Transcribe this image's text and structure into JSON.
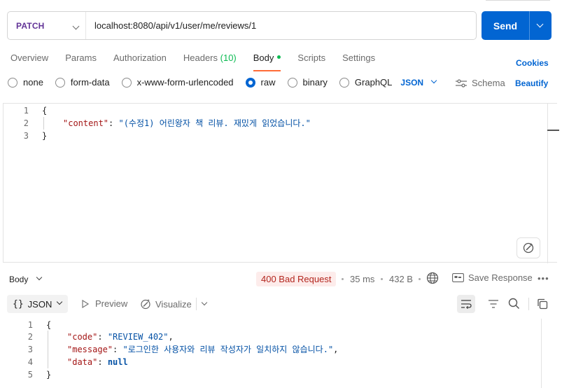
{
  "request": {
    "method": "PATCH",
    "url": "localhost:8080/api/v1/user/me/reviews/1",
    "send_label": "Send"
  },
  "tabs": [
    {
      "label": "Overview"
    },
    {
      "label": "Params"
    },
    {
      "label": "Authorization"
    },
    {
      "label": "Headers",
      "count": "(10)"
    },
    {
      "label": "Body"
    },
    {
      "label": "Scripts"
    },
    {
      "label": "Settings"
    }
  ],
  "cookies_label": "Cookies",
  "body_options": {
    "none": "none",
    "form_data": "form-data",
    "urlencoded": "x-www-form-urlencoded",
    "raw": "raw",
    "binary": "binary",
    "graphql": "GraphQL",
    "format": "JSON",
    "selected": "raw"
  },
  "schema_label": "Schema",
  "beautify_label": "Beautify",
  "request_body": {
    "line_numbers": [
      "1",
      "2",
      "3"
    ],
    "open_brace": "{",
    "key": "\"content\"",
    "colon": ": ",
    "value": "\"(수정1) 어린왕자 책 리뷰. 재밌게 읽었습니다.\"",
    "close_brace": "}"
  },
  "response": {
    "body_label": "Body",
    "status": "400 Bad Request",
    "time": "35 ms",
    "size": "432 B",
    "save_label": "Save Response",
    "more": "•••",
    "format": "JSON",
    "format_prefix": "{}",
    "preview_label": "Preview",
    "visualize_label": "Visualize",
    "line_numbers": [
      "1",
      "2",
      "3",
      "4",
      "5"
    ],
    "open_brace": "{",
    "close_brace": "}",
    "code_key": "\"code\"",
    "code_value": "\"REVIEW_402\"",
    "message_key": "\"message\"",
    "message_value": "\"로그인한 사용자와 리뷰 작성자가 일치하지 않습니다.\"",
    "data_key": "\"data\"",
    "data_value": "null",
    "colon": ": ",
    "comma": ","
  },
  "colors": {
    "method": "#623497",
    "send": "#0265d2",
    "accent": "#ff6c37",
    "status_bg": "#fdeceb",
    "status_fg": "#b3261e",
    "json_key": "#a31515",
    "json_value": "#0451a5"
  },
  "icons": [
    "chevron-down-icon",
    "schema-icon",
    "magic-wand-icon",
    "globe-icon",
    "save-icon",
    "play-icon",
    "visualize-icon",
    "wrap-lines-icon",
    "filter-icon",
    "search-icon",
    "copy-icon"
  ]
}
